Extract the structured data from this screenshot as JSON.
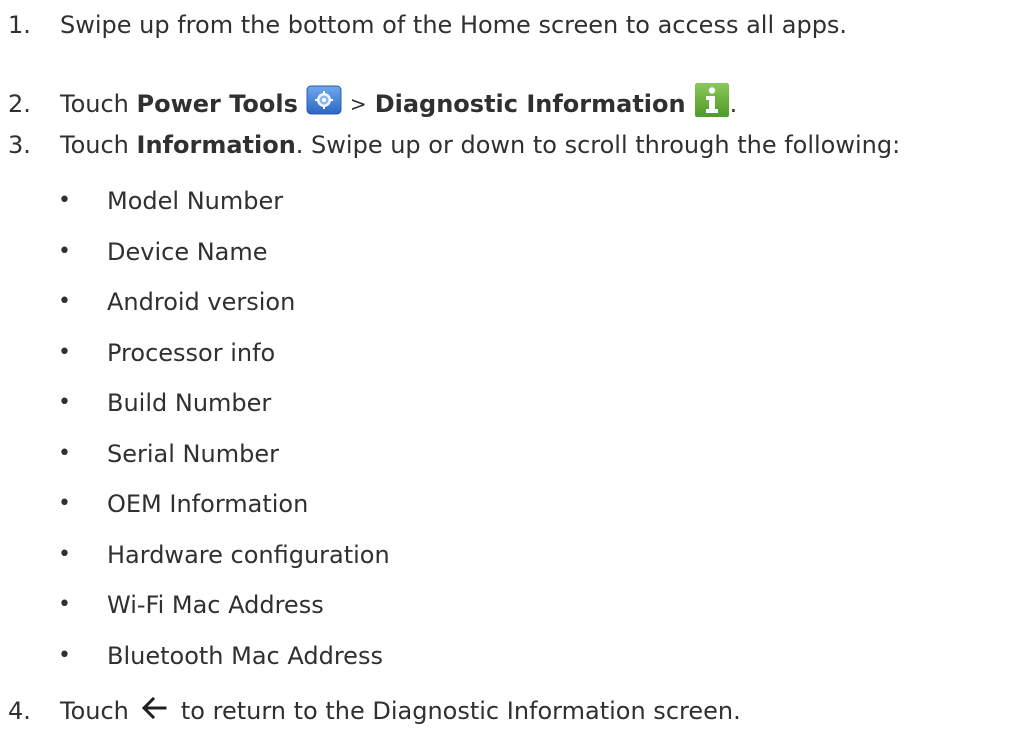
{
  "steps": [
    {
      "number": "1.",
      "text": "Swipe up from the bottom of the Home screen to access all apps."
    },
    {
      "number": "2.",
      "touch": "Touch",
      "power_tools": "Power Tools",
      "separator": ">",
      "diagnostic_information": "Diagnostic Information",
      "end": ".",
      "icons": [
        "power-tools-icon",
        "diagnostic-information-icon"
      ]
    },
    {
      "number": "3.",
      "touch": "Touch",
      "information": "Information",
      "rest": ". Swipe up or down to scroll through the following:"
    },
    {
      "number": "4.",
      "touch": "Touch",
      "icon": "back-arrow-icon",
      "rest": "to return to the Diagnostic Information screen."
    }
  ],
  "bullet_symbol": "•",
  "info_items": [
    "Model Number",
    "Device Name",
    "Android version",
    "Processor info",
    "Build Number",
    "Serial Number",
    "OEM Information",
    "Hardware configuration",
    "Wi-Fi Mac Address",
    "Bluetooth Mac Address"
  ],
  "colors": {
    "text": "#303030",
    "power_tools_icon": "#3c7fd6",
    "diagnostic_icon": "#6fb43f"
  }
}
